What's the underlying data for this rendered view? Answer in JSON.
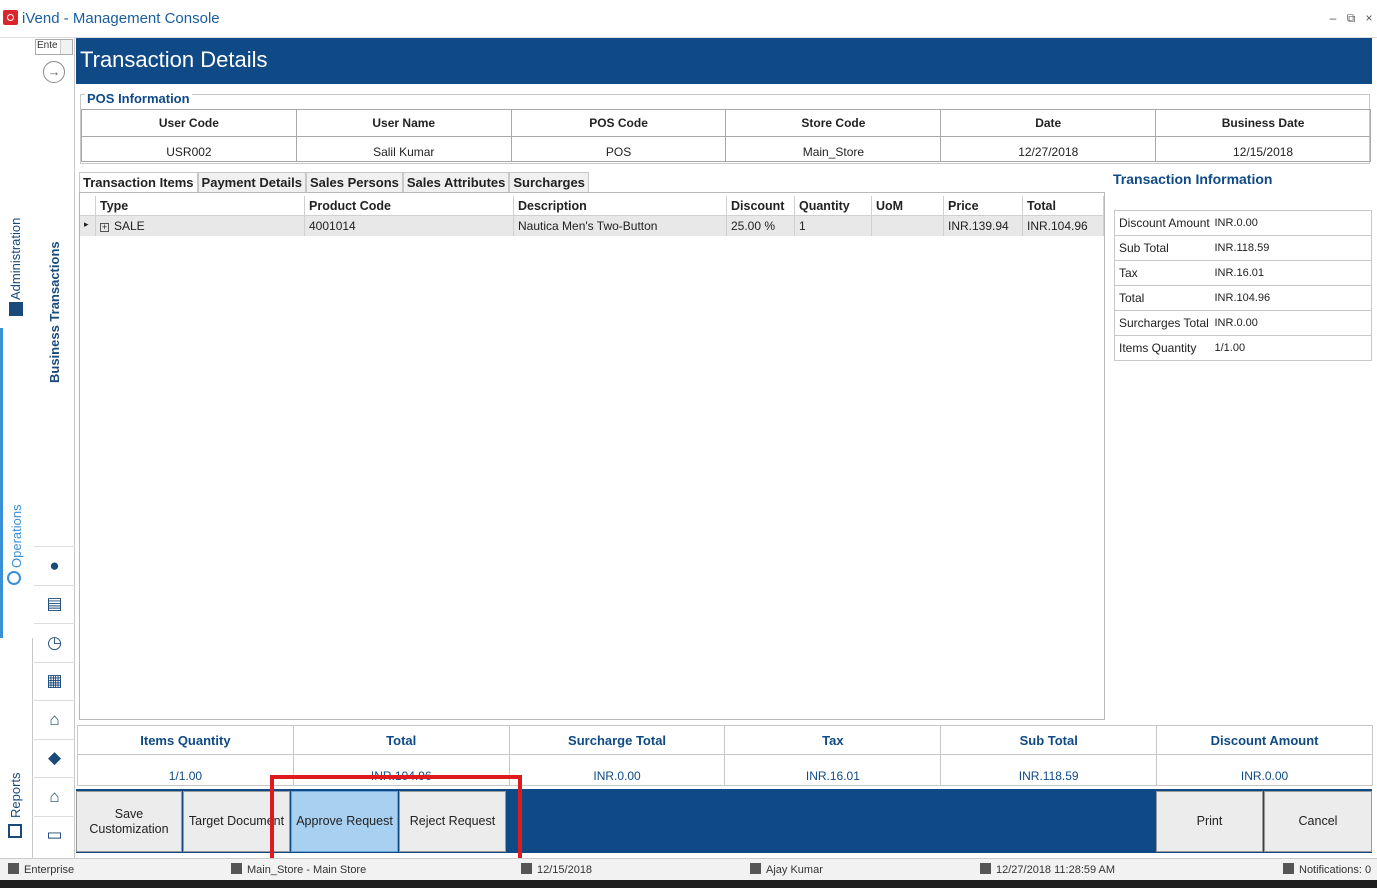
{
  "window": {
    "title": "iVend - Management Console",
    "minimize": "–",
    "restore": "⧉",
    "close": "×"
  },
  "left_tabs": {
    "administration": "Administration",
    "operations": "Operations",
    "reports": "Reports"
  },
  "nav": {
    "search_value": "Ente",
    "section_label": "Business Transactions"
  },
  "page": {
    "title": "Transaction Details"
  },
  "pos_info": {
    "section_title": "POS Information",
    "headers": [
      "User Code",
      "User Name",
      "POS Code",
      "Store Code",
      "Date",
      "Business Date"
    ],
    "values": [
      "USR002",
      "Salil Kumar",
      "POS",
      "Main_Store",
      "12/27/2018",
      "12/15/2018"
    ]
  },
  "tabs": [
    "Transaction Items",
    "Payment Details",
    "Sales Persons",
    "Sales Attributes",
    "Surcharges"
  ],
  "items_grid": {
    "columns": [
      "Type",
      "Product Code",
      "Description",
      "Discount",
      "Quantity",
      "UoM",
      "Price",
      "Total"
    ],
    "rows": [
      {
        "type": "SALE",
        "product_code": "4001014",
        "description": "Nautica Men's Two-Button",
        "discount": "25.00 %",
        "quantity": "1",
        "uom": "",
        "price": "INR.139.94",
        "total": "INR.104.96"
      }
    ]
  },
  "transaction_info": {
    "title": "Transaction Information",
    "rows": [
      {
        "label": "Discount Amount",
        "value": "INR.0.00"
      },
      {
        "label": "Sub Total",
        "value": "INR.118.59"
      },
      {
        "label": "Tax",
        "value": "INR.16.01"
      },
      {
        "label": "Total",
        "value": "INR.104.96"
      },
      {
        "label": "Surcharges Total",
        "value": "INR.0.00"
      },
      {
        "label": "Items Quantity",
        "value": "1/1.00"
      }
    ]
  },
  "summary": {
    "headers": [
      "Items Quantity",
      "Total",
      "Surcharge Total",
      "Tax",
      "Sub Total",
      "Discount Amount"
    ],
    "values": [
      "1/1.00",
      "INR.104.96",
      "INR.0.00",
      "INR.16.01",
      "INR.118.59",
      "INR.0.00"
    ]
  },
  "actions": {
    "save_customization": "Save Customization",
    "target_document": "Target Document",
    "approve_request": "Approve Request",
    "reject_request": "Reject Request",
    "print": "Print",
    "cancel": "Cancel"
  },
  "status": {
    "edition": "Enterprise",
    "store": "Main_Store - Main Store",
    "business_date": "12/15/2018",
    "user": "Ajay Kumar",
    "login_time": "12/27/2018 11:28:59 AM",
    "notifications": "Notifications: 0"
  },
  "colors": {
    "brand": "#0f4a86",
    "accent": "#3a8fd5",
    "highlight": "#e0191f",
    "active_button": "#a8d0f0"
  }
}
